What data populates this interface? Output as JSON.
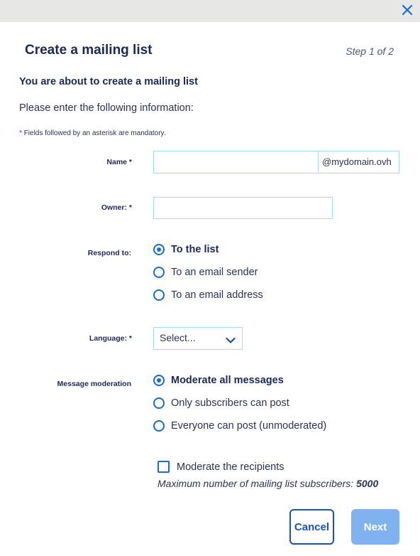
{
  "dialog": {
    "title": "Create a mailing list",
    "step": "Step 1 of 2",
    "intro": "You are about to create a mailing list",
    "info": "Please enter the following information:",
    "mandatory_asterisk": "*",
    "mandatory_note": "Fields followed by an asterisk are mandatory."
  },
  "name": {
    "label": "Name *",
    "value": "",
    "placeholder": "",
    "suffix": "@mydomain.ovh"
  },
  "owner": {
    "label": "Owner: *",
    "value": "",
    "placeholder": ""
  },
  "respond": {
    "label": "Respond to:",
    "options": [
      "To the list",
      "To an email sender",
      "To an email address"
    ],
    "selected_index": 0
  },
  "language": {
    "label": "Language: *",
    "selected": "Select..."
  },
  "moderation": {
    "label": "Message moderation",
    "options": [
      "Moderate all messages",
      "Only subscribers can post",
      "Everyone can post (unmoderated)"
    ],
    "selected_index": 0
  },
  "recipients": {
    "checkbox_label": "Moderate the recipients",
    "checked": false,
    "max_label": "Maximum number of mailing list subscribers:",
    "max_value": "5000"
  },
  "buttons": {
    "cancel": "Cancel",
    "next": "Next"
  },
  "colors": {
    "accent": "#1a6bd4",
    "title": "#1d2955",
    "input_border": "#a8dcea",
    "next_disabled": "#7fb2ee",
    "required": "#e0004d"
  },
  "icons": {
    "close": "close-icon",
    "chevron": "chevron-down-icon"
  }
}
